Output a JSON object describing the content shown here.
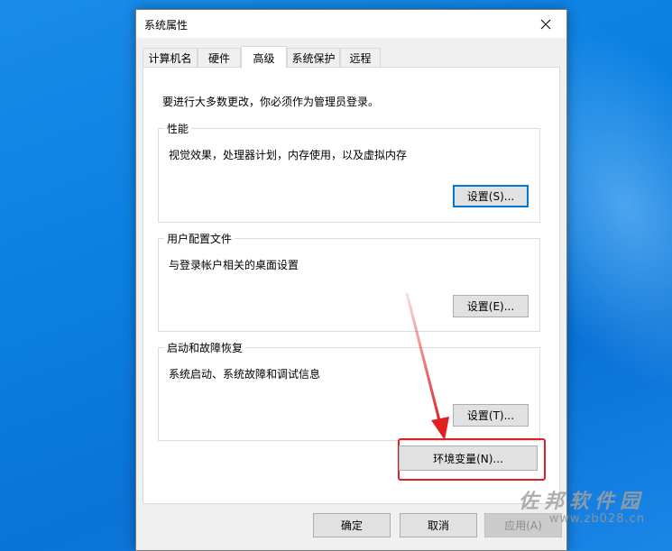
{
  "window": {
    "title": "系统属性"
  },
  "tabs": [
    {
      "label": "计算机名"
    },
    {
      "label": "硬件"
    },
    {
      "label": "高级"
    },
    {
      "label": "系统保护"
    },
    {
      "label": "远程"
    }
  ],
  "advanced": {
    "admin_note": "要进行大多数更改，你必须作为管理员登录。",
    "performance": {
      "label": "性能",
      "description": "视觉效果，处理器计划，内存使用，以及虚拟内存",
      "button": "设置(S)..."
    },
    "user_profiles": {
      "label": "用户配置文件",
      "description": "与登录帐户相关的桌面设置",
      "button": "设置(E)..."
    },
    "startup_recovery": {
      "label": "启动和故障恢复",
      "description": "系统启动、系统故障和调试信息",
      "button": "设置(T)..."
    },
    "env_button": "环境变量(N)..."
  },
  "footer": {
    "ok": "确定",
    "cancel": "取消",
    "apply": "应用(A)"
  },
  "watermark": {
    "name": "佐邦软件园",
    "url": "www.zb028.cn"
  },
  "colors": {
    "annotation_red": "#e02020",
    "focus_blue": "#0078d7"
  }
}
